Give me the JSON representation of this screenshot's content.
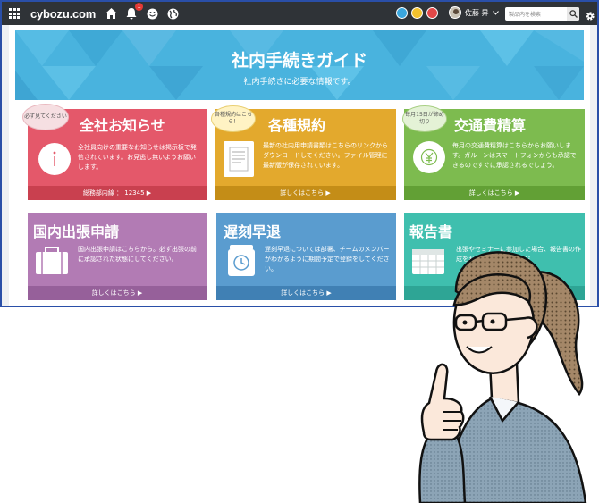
{
  "topbar": {
    "logo": "cybozu.com",
    "notification_count": "1",
    "user_name": "佐藤 昇",
    "search_placeholder": "製品内を検索"
  },
  "hero": {
    "title": "社内手続きガイド",
    "subtitle": "社内手続きに必要な情報です。"
  },
  "cards": [
    {
      "title": "全社お知らせ",
      "bubble": "必ず見てください",
      "desc": "全社員向けの重要なお知らせは掲示板で発信されています。お見逃し無いようお願いします。",
      "footer": "総務部内線 ： 12345 ▶",
      "color": "#e4586a",
      "foot_color": "#c9404f"
    },
    {
      "title": "各種規約",
      "bubble": "各種規約はこちら！",
      "desc": "最新の社内用申請書類はこちらのリンクからダウンロードしてください。ファイル管理に最新版が保存されています。",
      "footer": "詳しくはこちら ▶",
      "color": "#e3a92d",
      "foot_color": "#c48d17"
    },
    {
      "title": "交通費精算",
      "bubble": "毎月15日が締め切り",
      "desc": "毎月の交通費精算はこちらからお願いします。ガルーンはスマートフォンからも承認できるのですぐに承認されるでしょう。",
      "footer": "詳しくはこちら ▶",
      "color": "#7dbb4f",
      "foot_color": "#62a035"
    },
    {
      "title": "国内出張申請",
      "desc": "国内出張申請はこちらから。必ず出張の前に承認された状態にしてください。",
      "footer": "詳しくはこちら ▶",
      "color": "#b27bb4",
      "foot_color": "#96609a"
    },
    {
      "title": "遅刻早退",
      "desc": "遅刻早退については部署、チームのメンバーがわかるように期間予定で登録をしてください。",
      "footer": "詳しくはこちら ▶",
      "color": "#5a9ccf",
      "foot_color": "#4080b4"
    },
    {
      "title": "報告書",
      "desc": "出張やセミナーに参加した場合、報告書の作成をお願いします。スケジ",
      "footer": "",
      "color": "#3fbfae",
      "foot_color": "#2ea595"
    }
  ]
}
